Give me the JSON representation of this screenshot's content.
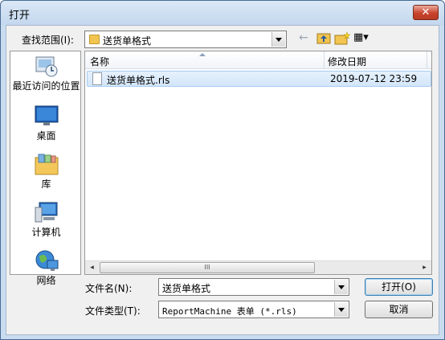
{
  "window": {
    "title": "打开",
    "close_glyph": "✕"
  },
  "toolbar": {
    "lookin_label": "查找范围(I):",
    "lookin_value": "送货单格式",
    "back_glyph": "←",
    "views_glyph": "▦▾"
  },
  "places": [
    {
      "label": "最近访问的位置",
      "icon": "recent-places-icon"
    },
    {
      "label": "桌面",
      "icon": "desktop-icon"
    },
    {
      "label": "库",
      "icon": "libraries-icon"
    },
    {
      "label": "计算机",
      "icon": "computer-icon"
    },
    {
      "label": "网络",
      "icon": "network-icon"
    }
  ],
  "filelist": {
    "columns": [
      "名称",
      "修改日期"
    ],
    "files": [
      {
        "name": "送货单格式.rls",
        "modified": "2019-07-12 23:59"
      }
    ],
    "scroll_left": "◂",
    "scroll_right": "▸",
    "thumb_grip": "III"
  },
  "form": {
    "filename_label": "文件名(N):",
    "filename_value": "送货单格式",
    "filetype_label": "文件类型(T):",
    "filetype_value": "ReportMachine 表单 (*.rls)",
    "open_label": "打开(O)",
    "cancel_label": "取消"
  }
}
